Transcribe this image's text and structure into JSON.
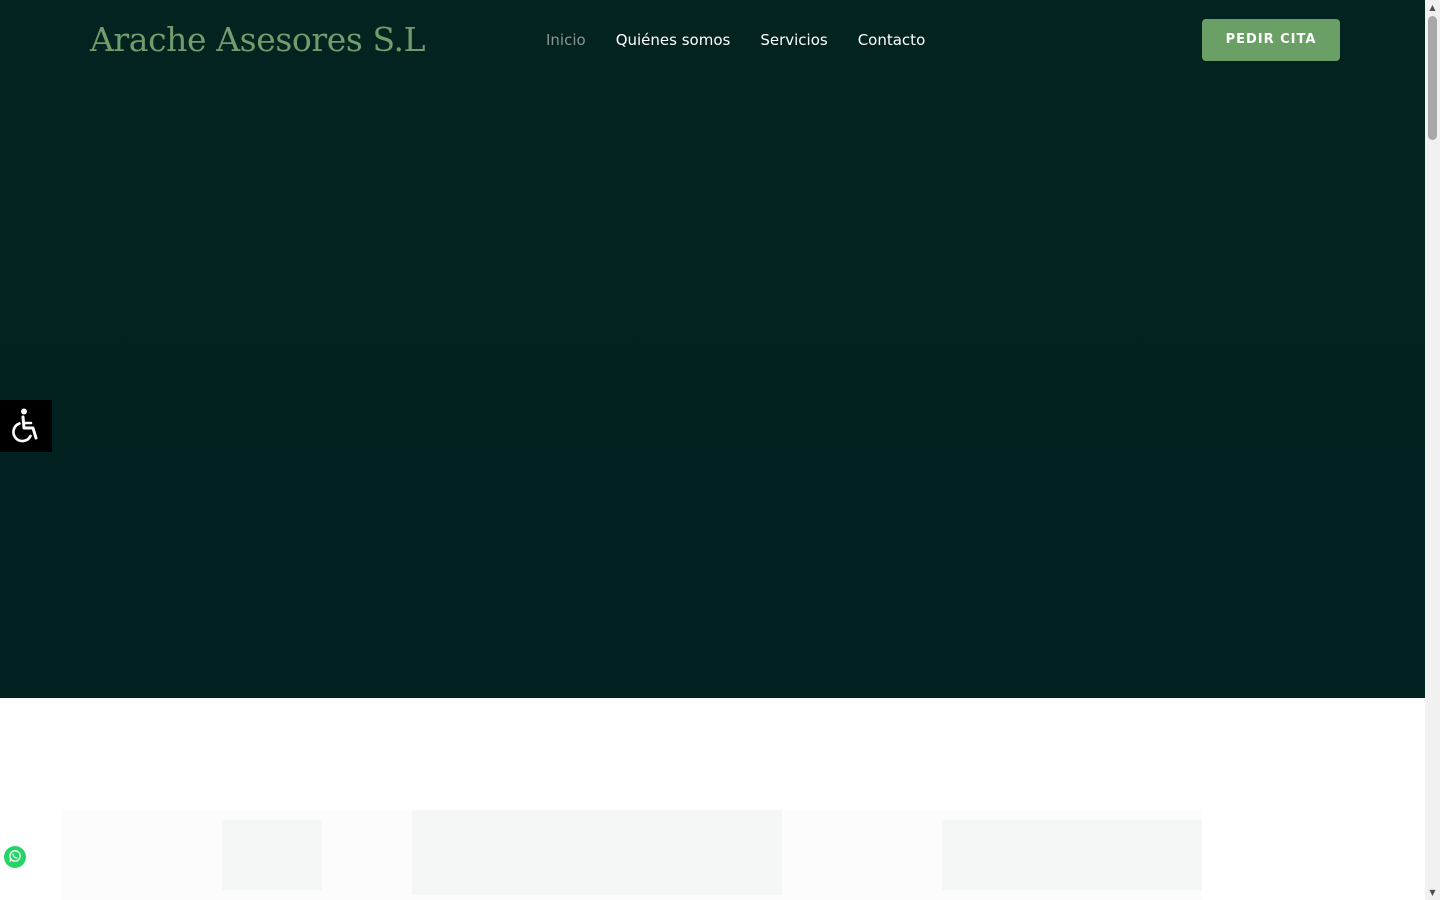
{
  "header": {
    "logo": "Arache Asesores S.L",
    "nav": [
      {
        "label": "Inicio",
        "active": true
      },
      {
        "label": "Quiénes somos",
        "active": false
      },
      {
        "label": "Servicios",
        "active": false
      },
      {
        "label": "Contacto",
        "active": false
      }
    ],
    "cta_label": "PEDIR CITA"
  },
  "widgets": {
    "accessibility_icon": "wheelchair-icon",
    "whatsapp_icon": "whatsapp-icon"
  },
  "colors": {
    "hero_bg": "#012221",
    "brand_green": "#6e9e6b",
    "cta_bg": "#6aa066",
    "nav_active": "#8b9694"
  }
}
